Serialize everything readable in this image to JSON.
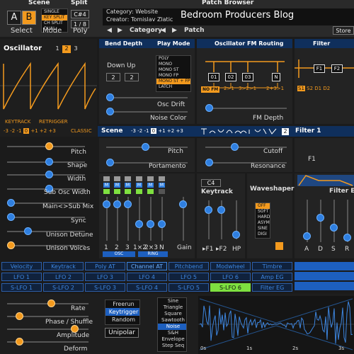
{
  "scene": {
    "title": "Scene",
    "a": "A",
    "b": "B",
    "select": "Select"
  },
  "split": {
    "title": "Split",
    "note": "C#4",
    "fraction": "1 / 8",
    "poly": "Poly"
  },
  "mode": {
    "items": [
      "SINGLE",
      "KEY SPLIT",
      "CH SPLIT",
      "DUAL"
    ],
    "label": "Mode"
  },
  "patch": {
    "browser_title": "Patch Browser",
    "category_label": "Category: Website",
    "creator_label": "Creator: Tomislav Zlatic",
    "name": "Bedroom Producers Blog",
    "category": "Category",
    "patch": "Patch",
    "store": "Store"
  },
  "oscillator": {
    "title": "Oscillator",
    "waves": [
      "1",
      "2",
      "3"
    ],
    "keytrack": "KEYTRACK",
    "retrigger": "RETRIGGER",
    "octaves": [
      "-3",
      "-2",
      "-1",
      "0",
      "+1",
      "+2",
      "+3"
    ],
    "classic": "CLASSIC"
  },
  "osc_sliders": [
    "Pitch",
    "Shape",
    "Width",
    "Sub Osc Width",
    "Main<>Sub Mix",
    "Sync",
    "Unison Detune",
    "Unison Voices"
  ],
  "bend": {
    "title": "Bend Depth",
    "down": "Down",
    "up": "Up",
    "down_val": "2",
    "up_val": "2"
  },
  "play_mode": {
    "title": "Play Mode",
    "items": [
      "POLY",
      "MONO",
      "MONO ST",
      "MONO FP",
      "MONO ST + FP",
      "LATCH"
    ],
    "selected": 4
  },
  "osc_drift": "Osc Drift",
  "noise_color": "Noise Color",
  "fm": {
    "title": "Oscillator FM Routing",
    "nodes": [
      "01",
      "02",
      "03",
      "N"
    ],
    "nofm": "NO FM",
    "routes": [
      "2>1",
      "3>2>1",
      "2+3>1"
    ],
    "depth": "FM Depth"
  },
  "filter_config": {
    "title": "Filter Configu",
    "nodes": [
      "F1",
      "F2"
    ],
    "modes": [
      "S1",
      "S2",
      "D1",
      "D2"
    ]
  },
  "scene_bar": {
    "label": "Scene",
    "octaves": [
      "-3",
      "-2",
      "-1",
      "0",
      "+1",
      "+2",
      "+3"
    ],
    "filter": "Filter 1",
    "filter_num": "2"
  },
  "mid_sliders": {
    "pitch": "Pitch",
    "portamento": "Portamento",
    "cutoff": "Cutoff",
    "resonance": "Resonance",
    "f1": "F1"
  },
  "mixer": {
    "labels": [
      "1",
      "2",
      "3",
      "1×2",
      "2×3",
      "N",
      "Gain"
    ],
    "osc": "OSC",
    "ring": "RING"
  },
  "keytrack": {
    "note": "C4",
    "title": "Keytrack",
    "f1": "▸F1",
    "f2": "▸F2",
    "hp": "HP"
  },
  "waveshaper": {
    "title": "Waveshaper",
    "items": [
      "OFF",
      "SOFT",
      "HARD",
      "ASYM",
      "SINE",
      "DIGI"
    ]
  },
  "filter_eg": {
    "title": "Filter EG",
    "labels": [
      "A",
      "D",
      "S",
      "R"
    ]
  },
  "mod_sources_row1": [
    "Velocity",
    "Keytrack",
    "Poly AT",
    "Channel AT",
    "Pitchbend",
    "Modwheel",
    "Timbre"
  ],
  "mod_sources_row2": [
    "LFO 1",
    "LFO 2",
    "LFO 3",
    "LFO 4",
    "LFO 5",
    "LFO 6",
    "Amp EG"
  ],
  "mod_sources_row3": [
    "S-LFO 1",
    "S-LFO 2",
    "S-LFO 3",
    "S-LFO 4",
    "S-LFO 5",
    "S-LFO 6",
    "Filter EG"
  ],
  "lfo_sliders": [
    "Rate",
    "Phase / Shuffle",
    "Amplitude",
    "Deform"
  ],
  "lfo_trigger": {
    "items": [
      "Freerun",
      "Keytrigger",
      "Random"
    ],
    "unipolar": "Unipolar"
  },
  "lfo_shapes": [
    "Sine",
    "Triangle",
    "Square",
    "Sawtooth",
    "Noise",
    "S&H",
    "Envelope",
    "Step Seq"
  ],
  "lfo_display": {
    "ticks": [
      "0s",
      "1s",
      "2s",
      "3s"
    ]
  },
  "colors": {
    "accent": "#f39a1e",
    "blue": "#2f7fe0",
    "header": "#0f2f5c",
    "green": "#7ee040"
  }
}
